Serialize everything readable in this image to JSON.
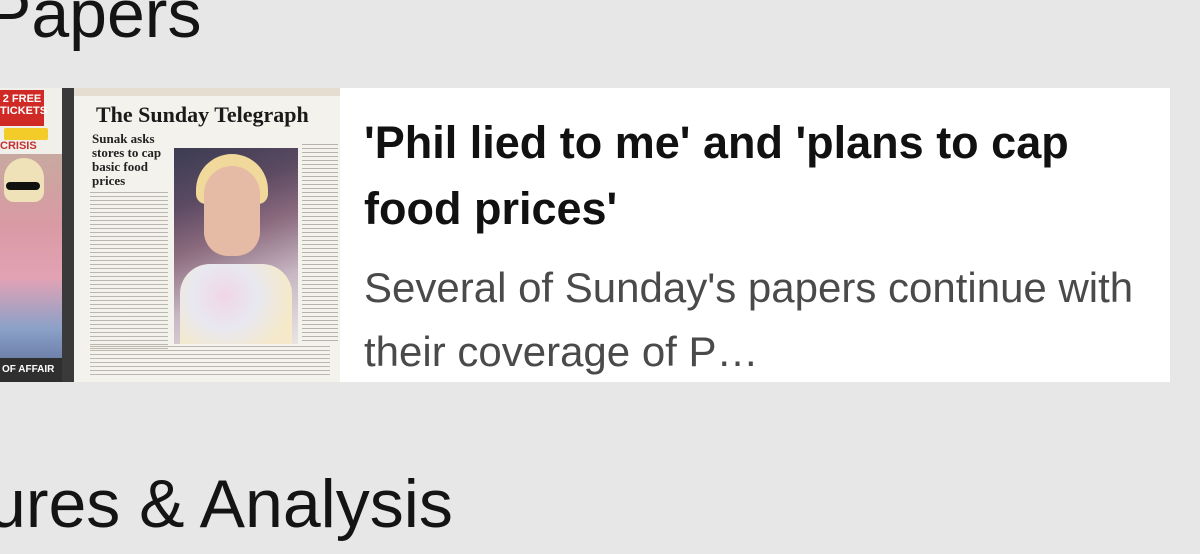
{
  "sections": {
    "top_heading": "Papers",
    "bottom_heading": "ures & Analysis"
  },
  "article": {
    "title": "'Phil lied to me' and 'plans to cap food prices'",
    "summary": "Several of Sunday's papers continue with their coverage of P…",
    "thumbnail": {
      "masthead": "The Sunday Telegraph",
      "headline": "Sunak asks stores to cap basic food prices",
      "left_badge": "2 FREE TICKETS",
      "left_kicker": "CRISIS",
      "left_footer": "OF AFFAIR"
    }
  }
}
